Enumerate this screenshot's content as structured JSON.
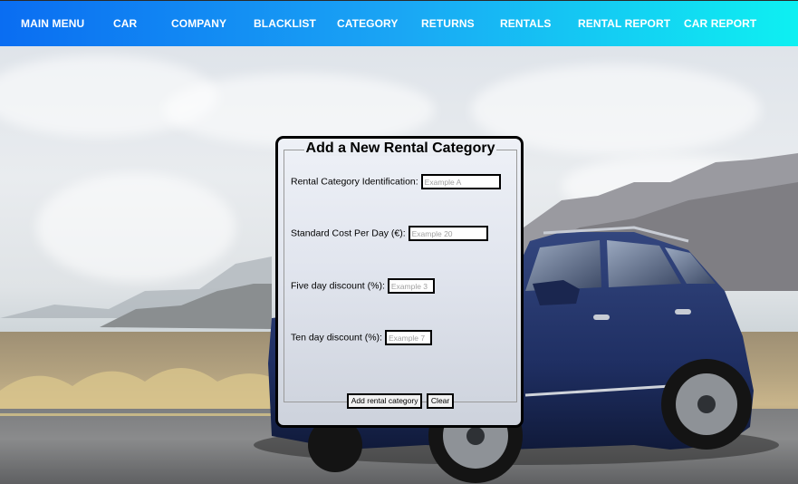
{
  "nav": {
    "items": [
      {
        "label": "MAIN MENU"
      },
      {
        "label": "CAR"
      },
      {
        "label": "COMPANY"
      },
      {
        "label": "BLACKLIST"
      },
      {
        "label": "CATEGORY"
      },
      {
        "label": "RETURNS"
      },
      {
        "label": "RENTALS"
      },
      {
        "label": "RENTAL REPORT"
      },
      {
        "label": "CAR REPORT"
      }
    ]
  },
  "form": {
    "title": "Add a New Rental Category",
    "fields": [
      {
        "label": "Rental Category Identification:",
        "value": "",
        "placeholder": "Example A"
      },
      {
        "label": "Standard Cost Per Day (€):",
        "value": "",
        "placeholder": "Example 20"
      },
      {
        "label": "Five day discount (%):",
        "value": "",
        "placeholder": "Example 3"
      },
      {
        "label": "Ten day discount (%):",
        "value": "",
        "placeholder": "Example 7"
      }
    ],
    "submit_label": "Add rental category",
    "clear_label": "Clear"
  },
  "colors": {
    "nav_gradient_start": "#0a6df2",
    "nav_gradient_end": "#0ef0f2",
    "car_body": "#1f2f63"
  }
}
